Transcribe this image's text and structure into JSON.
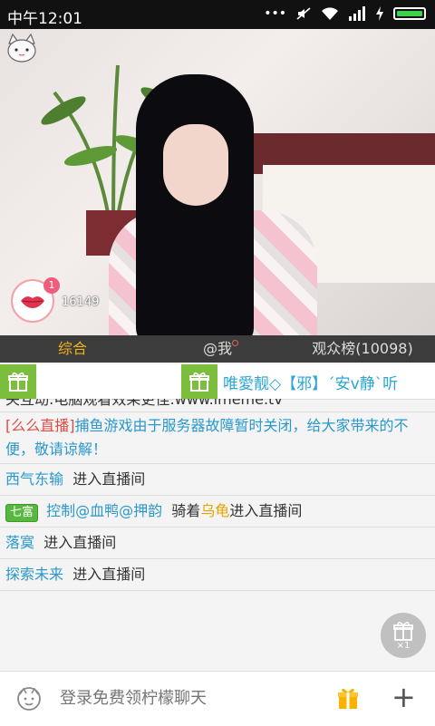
{
  "status_bar": {
    "time": "中午12:01"
  },
  "video": {
    "viewer_count": "16149",
    "badge_count": "1"
  },
  "tabs": [
    {
      "label": "综合",
      "active": true
    },
    {
      "label": "@我",
      "active": false
    },
    {
      "label": "观众榜(10098)",
      "active": false
    }
  ],
  "gift_bar": {
    "marquee": "唯愛靓◇【邪】´安v静`听"
  },
  "chat": {
    "partial_line": "关互动:电脑观看效果更佳:www.imeme.tv",
    "announce_tag": "[么么直播]",
    "announce_text": "捕鱼游戏由于服务器故障暂时关闭，给大家带来的不便，敬请谅解！",
    "messages": [
      {
        "user": "西气东输",
        "text": "进入直播间"
      },
      {
        "badge": "七富",
        "user": "控制@血鸭@押韵",
        "pre": "骑着",
        "mount": "乌龟",
        "text": "进入直播间"
      },
      {
        "user": "落寞",
        "text": "进入直播间"
      },
      {
        "user": "探索未来",
        "text": "进入直播间"
      }
    ]
  },
  "floating_gift": {
    "count": "×1"
  },
  "input_bar": {
    "placeholder": "登录免费领柠檬聊天"
  }
}
